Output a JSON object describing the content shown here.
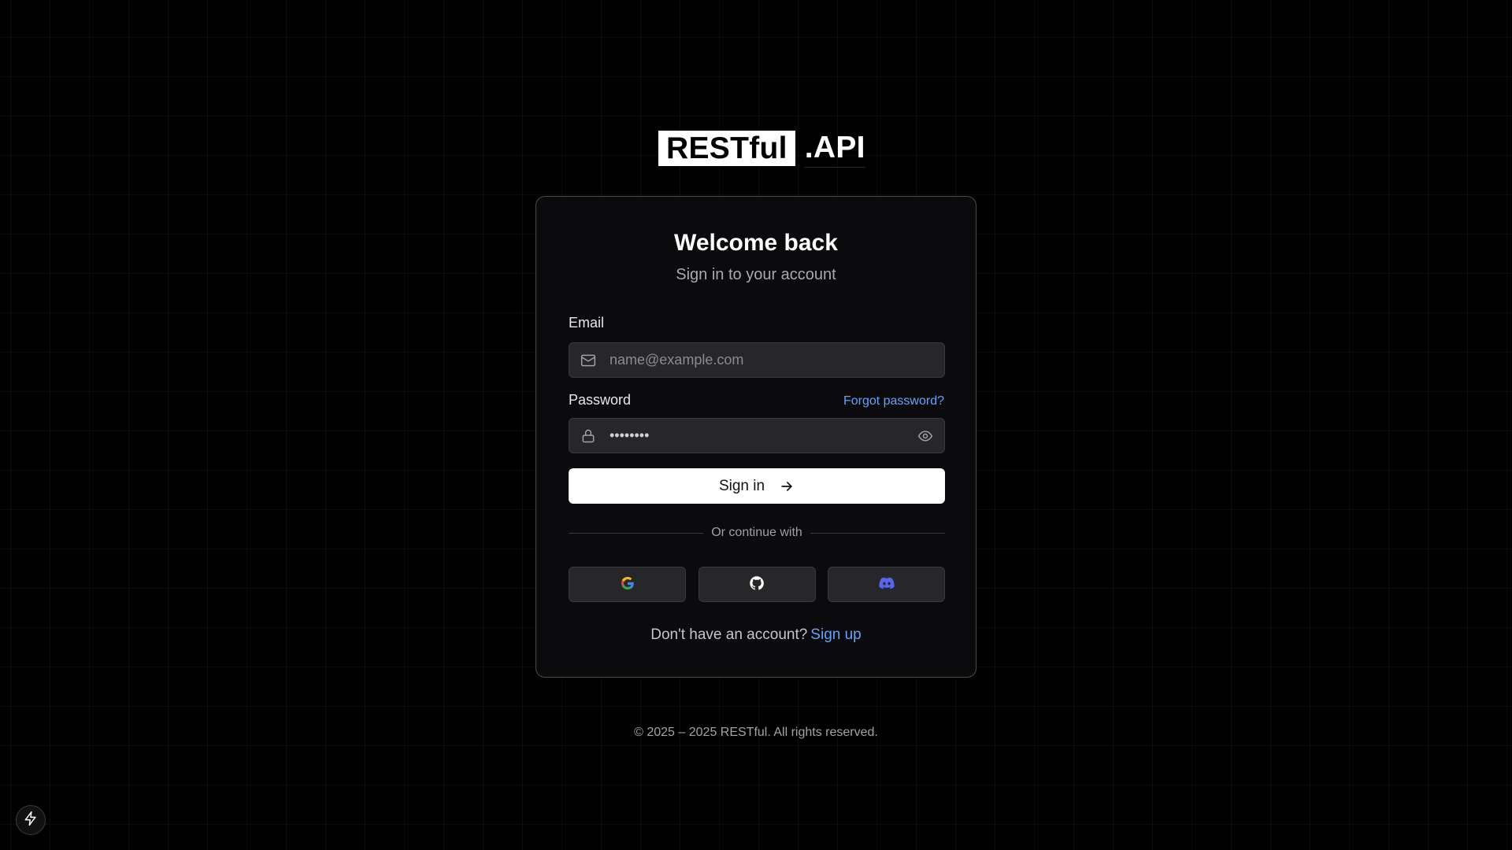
{
  "logo": {
    "box_text": "RESTful",
    "suffix": ".API"
  },
  "card": {
    "title": "Welcome back",
    "subtitle": "Sign in to your account",
    "email": {
      "label": "Email",
      "placeholder": "name@example.com",
      "value": "",
      "icon": "mail-icon"
    },
    "password": {
      "label": "Password",
      "value": "••••••••",
      "icon": "lock-icon",
      "toggle_icon": "eye-icon"
    },
    "forgot_label": "Forgot password?",
    "signin_label": "Sign in",
    "divider_text": "Or continue with",
    "social": [
      {
        "name": "google",
        "icon": "google-icon"
      },
      {
        "name": "github",
        "icon": "github-icon"
      },
      {
        "name": "discord",
        "icon": "discord-icon",
        "color": "#5865F2"
      }
    ],
    "signup_prompt": "Don't have an account?",
    "signup_link": "Sign up"
  },
  "footer": {
    "text": "© 2025 – 2025 RESTful. All rights reserved."
  },
  "colors": {
    "background": "#000000",
    "card": "#0b0b0d",
    "link": "#60a5fa",
    "field": "#27272a"
  },
  "corner_button": {
    "icon": "lightning-icon"
  }
}
